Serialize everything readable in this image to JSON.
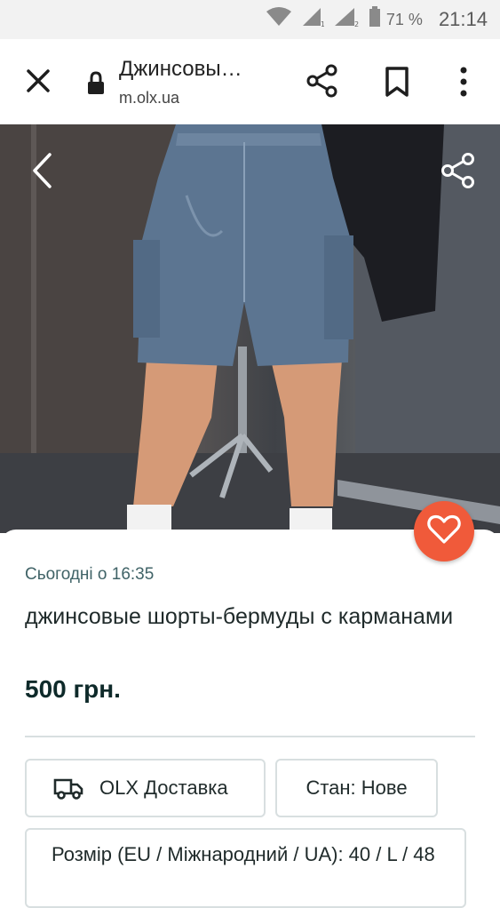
{
  "status_bar": {
    "battery_percent": "71 %",
    "time": "21:14",
    "icons": [
      "wifi-icon",
      "signal-sim1-icon",
      "signal-sim2-icon",
      "battery-icon"
    ]
  },
  "browser": {
    "page_title": "Джинсовы…",
    "url": "m.olx.ua",
    "icons": [
      "close-icon",
      "lock-icon",
      "share-icon",
      "bookmark-icon",
      "more-vert-icon"
    ]
  },
  "photo": {
    "icons": [
      "chevron-left-icon",
      "share-icon"
    ]
  },
  "listing": {
    "date": "Сьогодні о 16:35",
    "title": "джинсовые шорты-бермуды с карманами",
    "price": "500 грн.",
    "delivery_label": "OLX Доставка",
    "state_label": "Стан: Нове",
    "size_label": "Розмір (EU / Міжнародний / UA): 40 / L / 48"
  },
  "colors": {
    "accent_orange": "#f05a3a",
    "text_dark": "#1f2a2a",
    "text_muted": "#406367",
    "border": "#d8dfe0"
  }
}
